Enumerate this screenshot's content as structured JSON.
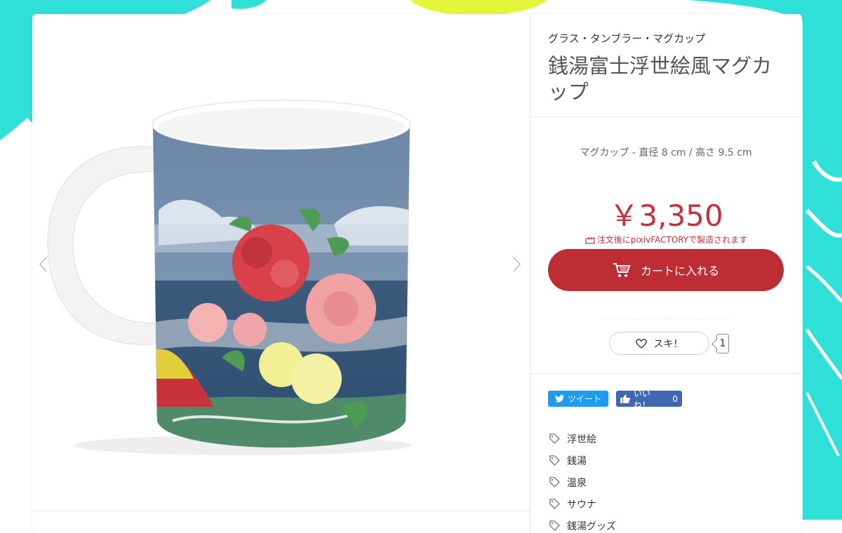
{
  "product": {
    "category": "グラス・タンブラー・マグカップ",
    "title": "銭湯富士浮世絵風マグカップ",
    "spec": "マグカップ - 直径 8 cm / 高さ 9.5 cm",
    "price": "￥3,350",
    "factory_note": "注文後にpixivFACTORYで製造されます",
    "cart_label": "カートに入れる"
  },
  "like": {
    "label": "スキ！",
    "count": "1"
  },
  "share": {
    "tweet_label": "ツイート",
    "fb_label": "いいね！",
    "fb_count": "0"
  },
  "tags": [
    "浮世絵",
    "銭湯",
    "温泉",
    "サウナ",
    "銭湯グッズ"
  ],
  "colors": {
    "accent": "#be2d33",
    "price": "#c9303c",
    "background_cyan": "#2fe0d8",
    "background_yellow": "#e4f53a",
    "twitter": "#1d9bf0",
    "facebook": "#4267b2"
  },
  "icons": {
    "prev": "chevron-left-icon",
    "next": "chevron-right-icon",
    "cart": "cart-icon",
    "heart": "heart-icon",
    "factory": "factory-icon",
    "twitter": "twitter-bird-icon",
    "facebook": "thumbs-up-icon",
    "tag": "tag-icon"
  }
}
